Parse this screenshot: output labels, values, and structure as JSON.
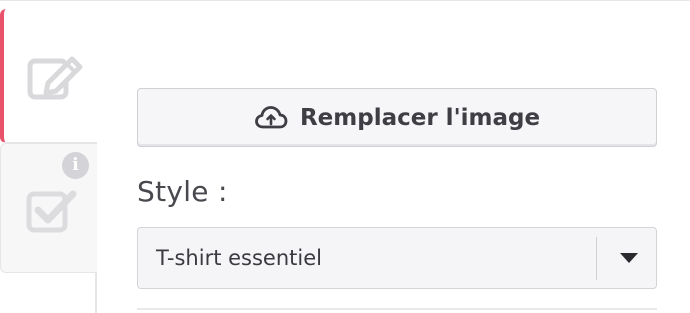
{
  "sidebar": {
    "tabs": [
      {
        "icon": "edit-icon",
        "active": true,
        "accent_color": "#e8536b"
      },
      {
        "icon": "checkbox-icon",
        "active": false,
        "badge": "i"
      }
    ]
  },
  "main": {
    "replace_button": {
      "icon": "cloud-upload-icon",
      "label": "Remplacer l'image"
    },
    "style_field": {
      "label": "Style :",
      "selected_value": "T-shirt essentiel"
    }
  },
  "colors": {
    "accent": "#e8536b",
    "text": "#3e3e44",
    "border": "#cfcfd4",
    "field_bg": "#f5f5f8"
  }
}
